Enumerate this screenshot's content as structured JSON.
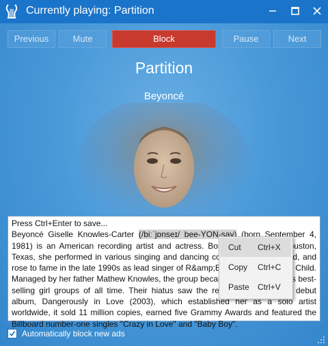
{
  "window": {
    "title": "Currently playing: Partition",
    "app_icon": "lyre-icon",
    "controls": [
      "minimize-icon",
      "maximize-icon",
      "close-icon"
    ]
  },
  "toolbar": {
    "previous": "Previous",
    "mute": "Mute",
    "block": "Block",
    "pause": "Pause",
    "next": "Next"
  },
  "song": {
    "title": "Partition",
    "artist": "Beyoncé"
  },
  "editor": {
    "hint": "Press Ctrl+Enter to save...",
    "text_before": "Beyoncé Giselle Knowles-Carter ",
    "selected_text": "(/biːˈjɒnseɪ/ bee-YON-say)",
    "text_after": " (born September 4, 1981) is an American recording artist and actress. Born and raised in Houston, Texas, she performed in various singing and dancing competitions as a child, and rose to fame in the late 1990s as lead singer of R&amp;B girl-group Destiny's Child. Managed by her father Mathew Knowles, the group became one of the world's best-selling girl groups of all time. Their hiatus saw the release of Beyoncé's debut album, Dangerously in Love (2003), which established her as a solo artist worldwide, it sold 11 million copies, earned five Grammy Awards and featured the Billboard number-one singles \"Crazy in Love\" and \"Baby Boy\"."
  },
  "context_menu": {
    "items": [
      {
        "label": "Cut",
        "shortcut": "Ctrl+X"
      },
      {
        "label": "Copy",
        "shortcut": "Ctrl+C"
      },
      {
        "label": "Paste",
        "shortcut": "Ctrl+V"
      }
    ]
  },
  "options": {
    "auto_block_label": "Automatically block new ads",
    "auto_block_checked": true
  },
  "colors": {
    "titlebar": "#1a74c9",
    "background": "#3a8fd4",
    "block_button": "#c8392e"
  }
}
